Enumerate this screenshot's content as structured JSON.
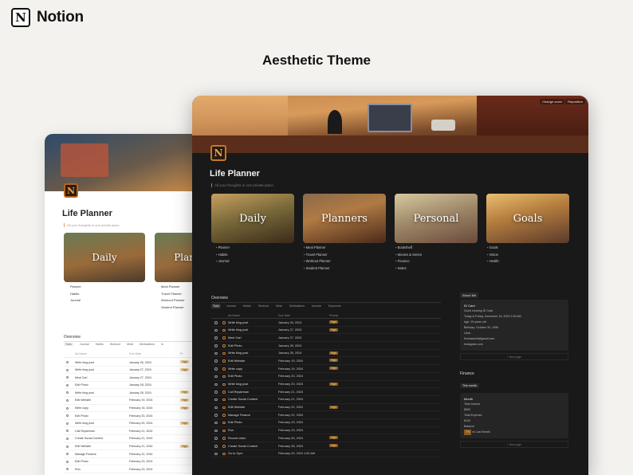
{
  "brand": {
    "logo_letter": "N",
    "name": "Notion"
  },
  "page_title": "Aesthetic Theme",
  "light": {
    "title": "Life Planner",
    "subtitle": "All your thoughts in one private place.",
    "tiles": [
      "Daily",
      "Planners"
    ],
    "daily_links": [
      "Planner",
      "Habits",
      "Journal"
    ],
    "planner_links": [
      "Meal Planner",
      "Travel Planner",
      "Workout Planner",
      "Student Planner"
    ],
    "overview_label": "Overview",
    "tabs": [
      "Todo",
      "Journal",
      "Habits",
      "Workout",
      "Meal",
      "Medications",
      "In"
    ],
    "col_name": "Aa Name",
    "col_due": "Due Date",
    "col_priority": "Pr",
    "rows": [
      {
        "name": "Write blog post",
        "due": "January 26, 2024",
        "priority": "High"
      },
      {
        "name": "Write blog post",
        "due": "January 27, 2024",
        "priority": "High"
      },
      {
        "name": "Meal Carl",
        "due": "January 27, 2024",
        "priority": ""
      },
      {
        "name": "Edit Photo",
        "due": "January 28, 2024",
        "priority": ""
      },
      {
        "name": "Write blog post",
        "due": "January 28, 2024",
        "priority": "High"
      },
      {
        "name": "Edit Website",
        "due": "February 19, 2024",
        "priority": "High"
      },
      {
        "name": "Write copy",
        "due": "February 19, 2024",
        "priority": "High"
      },
      {
        "name": "Edit Photo",
        "due": "February 20, 2024",
        "priority": ""
      },
      {
        "name": "Write blog post",
        "due": "February 20, 2024",
        "priority": "High"
      },
      {
        "name": "Call Repairman",
        "due": "February 21, 2024",
        "priority": ""
      },
      {
        "name": "Create Social Content",
        "due": "February 21, 2024",
        "priority": ""
      },
      {
        "name": "Edit Website",
        "due": "February 21, 2024",
        "priority": "High"
      },
      {
        "name": "Manage Finance",
        "due": "February 22, 2024",
        "priority": ""
      },
      {
        "name": "Edit Photo",
        "due": "February 23, 2024",
        "priority": ""
      },
      {
        "name": "Run",
        "due": "February 23, 2024",
        "priority": ""
      }
    ]
  },
  "dark": {
    "cover_buttons": [
      "Change cover",
      "Reposition"
    ],
    "title": "Life Planner",
    "subtitle": "All your thoughts in one private place.",
    "tiles": [
      {
        "label": "Daily",
        "links": [
          "Planner",
          "Habits",
          "Journal"
        ]
      },
      {
        "label": "Planners",
        "links": [
          "Meal Planner",
          "Travel Planner",
          "Workout Planner",
          "Student Planner"
        ]
      },
      {
        "label": "Personal",
        "links": [
          "Bookshelf",
          "Movies & Series",
          "Finance",
          "Notes"
        ]
      },
      {
        "label": "Goals",
        "links": [
          "Goals",
          "Vision",
          "Health"
        ]
      }
    ],
    "overview_label": "Overview",
    "tabs": [
      "Todo",
      "Journal",
      "Habits",
      "Workout",
      "Meal",
      "Medications",
      "Income",
      "Expenses"
    ],
    "col_name": "Aa Name",
    "col_due": "Due Date",
    "col_priority": "Priority",
    "rows": [
      {
        "name": "Write blog post",
        "due": "January 26, 2024",
        "priority": "High"
      },
      {
        "name": "Write blog post",
        "due": "January 27, 2024",
        "priority": "High"
      },
      {
        "name": "Meet Carl",
        "due": "January 27, 2024",
        "priority": ""
      },
      {
        "name": "Edit Photo",
        "due": "January 28, 2024",
        "priority": ""
      },
      {
        "name": "Write blog post",
        "due": "January 28, 2024",
        "priority": "High"
      },
      {
        "name": "Edit Website",
        "due": "February 19, 2024",
        "priority": "High"
      },
      {
        "name": "Write copy",
        "due": "February 19, 2024",
        "priority": "High"
      },
      {
        "name": "Edit Photo",
        "due": "February 20, 2024",
        "priority": ""
      },
      {
        "name": "Write blog post",
        "due": "February 20, 2024",
        "priority": "High"
      },
      {
        "name": "Call Repairman",
        "due": "February 21, 2024",
        "priority": ""
      },
      {
        "name": "Create Social Content",
        "due": "February 21, 2024",
        "priority": ""
      },
      {
        "name": "Edit Website",
        "due": "February 22, 2024",
        "priority": "High"
      },
      {
        "name": "Manage Finance",
        "due": "February 22, 2024",
        "priority": ""
      },
      {
        "name": "Edit Photo",
        "due": "February 23, 2024",
        "priority": ""
      },
      {
        "name": "Run",
        "due": "February 23, 2024",
        "priority": ""
      },
      {
        "name": "Record video",
        "due": "February 26, 2024",
        "priority": "High"
      },
      {
        "name": "Create Social Content",
        "due": "February 28, 2024",
        "priority": "High"
      },
      {
        "name": "Go to Gym",
        "due": "February 29, 2024 1:00 AM",
        "priority": ""
      }
    ],
    "about": {
      "chip": "About Me",
      "card_title": "ID Card",
      "lines": [
        "Good morning ID Card",
        "Today is Friday, December 15, 2023 1:00 AM",
        "Age: 29 years old",
        "Birthday: October 30, 1996",
        "Libra",
        "finnnaworld@gmail.com",
        "Instagram.com"
      ],
      "new_page": "+ New page"
    },
    "finance": {
      "title": "Finance",
      "tab": "This month",
      "card_title": "Month",
      "lines": [
        "Total Income",
        "$500",
        "Total Expense",
        "$100",
        "Balance"
      ],
      "badge": "7%",
      "badge_note": "vs Last Month",
      "new_page": "+ New page"
    }
  },
  "colors": {
    "accent": "#c27a2a",
    "dark_bg": "#191919",
    "light_bg": "#f3f2ef"
  }
}
